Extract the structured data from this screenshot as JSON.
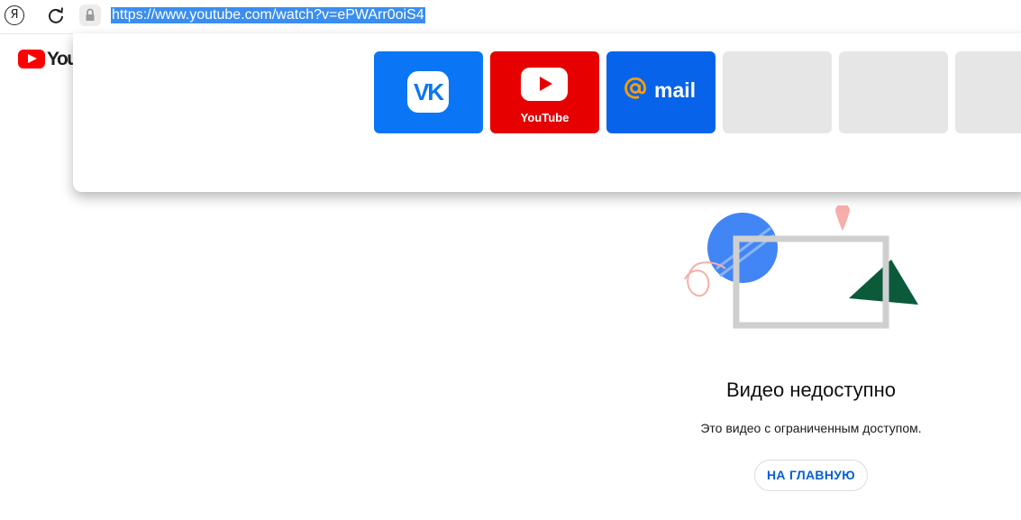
{
  "browser": {
    "home_glyph": "Я",
    "url": "https://www.youtube.com/watch?v=ePWArr0oiS4"
  },
  "youtube_logo": {
    "text": "YouTube"
  },
  "speed_dial": {
    "tiles": [
      {
        "id": "vk",
        "badge": "VK",
        "color": "#0a76f6"
      },
      {
        "id": "youtube",
        "caption": "YouTube",
        "color": "#e60000"
      },
      {
        "id": "mail",
        "word": "mail",
        "color": "#0764ea"
      }
    ]
  },
  "error": {
    "title": "Видео недоступно",
    "subtitle": "Это видео с ограниченным доступом.",
    "button": "НА ГЛАВНУЮ"
  },
  "colors": {
    "url_highlight": "#3a8ef0",
    "link_blue": "#065fd4"
  }
}
